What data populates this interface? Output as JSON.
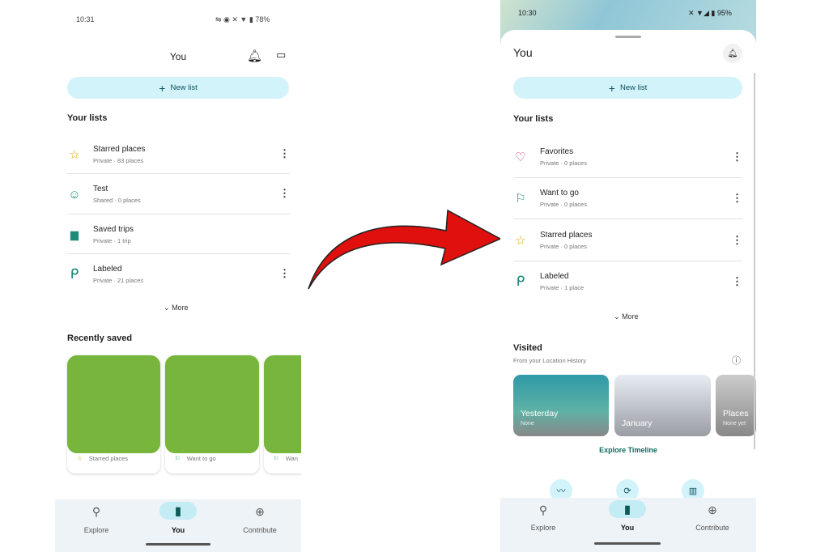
{
  "left": {
    "status": {
      "time": "10:31",
      "battery": "78%"
    },
    "header": {
      "title": "You"
    },
    "new_list": "New list",
    "your_lists_title": "Your lists",
    "lists": [
      {
        "name": "Starred places",
        "sub": "Private · 83 places",
        "icon": "star-icon",
        "color": "#e0a800"
      },
      {
        "name": "Test",
        "sub": "Shared · 0 places",
        "icon": "emoji-add-icon",
        "color": "#1e8a7a"
      },
      {
        "name": "Saved trips",
        "sub": "Private · 1 trip",
        "icon": "trips-icon",
        "color": "#1e8a7a"
      },
      {
        "name": "Labeled",
        "sub": "Private · 21 places",
        "icon": "label-flag-icon",
        "color": "#1e8a7a"
      }
    ],
    "more": "More",
    "recently_saved_title": "Recently saved",
    "recent": [
      {
        "label": "Starred places"
      },
      {
        "label": "Want to go"
      },
      {
        "label": "Wan"
      }
    ],
    "nav": [
      {
        "label": "Explore"
      },
      {
        "label": "You"
      },
      {
        "label": "Contribute"
      }
    ]
  },
  "right": {
    "status": {
      "time": "10:30",
      "battery": "95%"
    },
    "header": {
      "title": "You"
    },
    "new_list": "New list",
    "your_lists_title": "Your lists",
    "lists": [
      {
        "name": "Favorites",
        "sub": "Private · 0 places",
        "icon": "heart-icon",
        "color": "#c2185b"
      },
      {
        "name": "Want to go",
        "sub": "Private · 0 places",
        "icon": "flag-icon",
        "color": "#1e8a7a"
      },
      {
        "name": "Starred places",
        "sub": "Private · 0 places",
        "icon": "star-icon",
        "color": "#e0a800"
      },
      {
        "name": "Labeled",
        "sub": "Private · 1 place",
        "icon": "label-flag-icon",
        "color": "#1e8a7a"
      }
    ],
    "more": "More",
    "visited": {
      "title": "Visited",
      "subtitle": "From your Location History",
      "cards": [
        {
          "title": "Yesterday",
          "sub": "None"
        },
        {
          "title": "January",
          "sub": ""
        },
        {
          "title": "Places",
          "sub": "None yet"
        }
      ]
    },
    "explore_timeline": "Explore Timeline",
    "nav": [
      {
        "label": "Explore"
      },
      {
        "label": "You"
      },
      {
        "label": "Contribute"
      }
    ]
  },
  "colors": {
    "accent": "#d3f3fb",
    "arrow": "#e0100e",
    "teal": "#0b6b5e"
  }
}
